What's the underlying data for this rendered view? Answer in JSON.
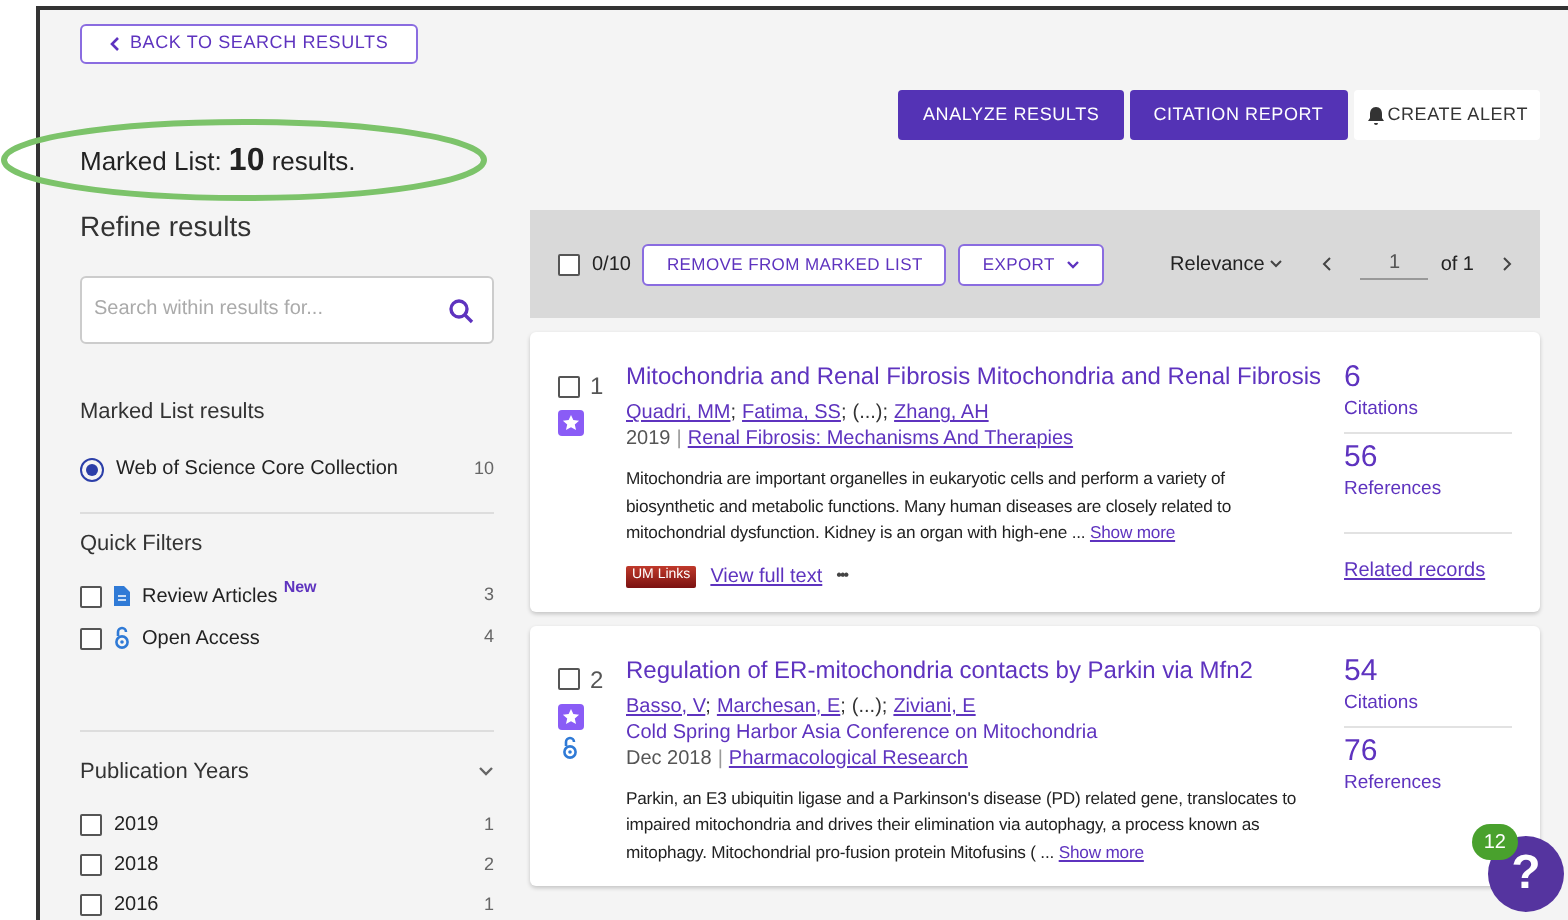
{
  "back_button": "BACK TO SEARCH RESULTS",
  "heading": {
    "prefix": "Marked List: ",
    "count": "10",
    "suffix": " results."
  },
  "refine_title": "Refine results",
  "search": {
    "placeholder": "Search within results for..."
  },
  "marked_list_results": {
    "title": "Marked List results",
    "options": [
      {
        "label": "Web of Science Core Collection",
        "count": "10",
        "selected": true
      }
    ]
  },
  "quick_filters": {
    "title": "Quick Filters",
    "items": [
      {
        "kind": "review",
        "label": "Review Articles",
        "badge": "New",
        "count": "3",
        "checked": false
      },
      {
        "kind": "open",
        "label": "Open Access",
        "count": "4",
        "checked": false
      }
    ]
  },
  "publication_years": {
    "title": "Publication Years",
    "expanded": true,
    "items": [
      {
        "label": "2019",
        "count": "1",
        "checked": false
      },
      {
        "label": "2018",
        "count": "2",
        "checked": false
      },
      {
        "label": "2016",
        "count": "1",
        "checked": false
      }
    ]
  },
  "actions": [
    {
      "label": "ANALYZE RESULTS",
      "kind": "primary"
    },
    {
      "label": "CITATION REPORT",
      "kind": "primary"
    },
    {
      "label": "CREATE ALERT",
      "kind": "alert"
    }
  ],
  "toolbar": {
    "select_all": {
      "checked": false,
      "label": "0/10"
    },
    "remove": "REMOVE FROM MARKED LIST",
    "export": "EXPORT",
    "sort": "Relevance",
    "page": "1",
    "of": "of 1"
  },
  "results": [
    {
      "number": "1",
      "checked": false,
      "marked": true,
      "title": "Mitochondria and Renal Fibrosis Mitochondria and Renal Fibrosis",
      "authors": [
        {
          "name": "Quadri, MM",
          "kind": "link",
          "sep": ";"
        },
        {
          "name": "Fatima, SS",
          "kind": "link",
          "sep": ";"
        },
        {
          "name": "(...)",
          "kind": "text",
          "sep": ";"
        },
        {
          "name": "Zhang, AH",
          "kind": "link"
        }
      ],
      "date": "2019",
      "date_sep": "|",
      "source": "Renal Fibrosis: Mechanisms And Therapies",
      "abstract": "Mitochondria are important organelles in eukaryotic cells and perform a variety of biosynthetic and metabolic functions. Many human diseases are closely related to mitochondrial dysfunction. Kidney is an organ with high-ene ...",
      "show_more": "Show more",
      "links_badge": "UM Links",
      "full_text": "View full text",
      "more": "•••",
      "citations": "6",
      "citations_label": "Citations",
      "references": "56",
      "references_label": "References",
      "related": "Related records"
    },
    {
      "number": "2",
      "checked": false,
      "marked": true,
      "open_access": true,
      "title": "Regulation of ER-mitochondria contacts by Parkin via Mfn2",
      "authors": [
        {
          "name": "Basso, V",
          "kind": "link",
          "sep": ";"
        },
        {
          "name": "Marchesan, E",
          "kind": "link",
          "sep": ";"
        },
        {
          "name": "(...)",
          "kind": "text",
          "sep": ";"
        },
        {
          "name": "Ziviani, E",
          "kind": "link"
        }
      ],
      "conference": "Cold Spring Harbor Asia Conference on Mitochondria",
      "date": "Dec 2018",
      "date_sep": "|",
      "source": "Pharmacological Research",
      "abstract": "Parkin, an E3 ubiquitin ligase and a Parkinson's disease (PD) related gene, translocates to impaired mitochondria and drives their elimination via autophagy, a process known as mitophagy. Mitochondrial pro-fusion protein Mitofusins ( ...",
      "show_more": "Show more",
      "citations": "54",
      "citations_label": "Citations",
      "references": "76",
      "references_label": "References"
    }
  ],
  "help": {
    "label": "?",
    "badge": "12"
  }
}
